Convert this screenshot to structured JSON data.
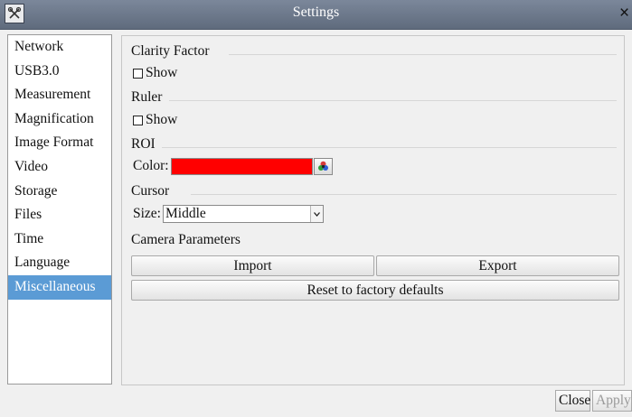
{
  "window": {
    "title": "Settings",
    "app_icon": "tools-icon",
    "close_glyph": "×"
  },
  "sidebar": {
    "items": [
      {
        "label": "Network"
      },
      {
        "label": "USB3.0"
      },
      {
        "label": "Measurement"
      },
      {
        "label": "Magnification"
      },
      {
        "label": "Image Format"
      },
      {
        "label": "Video"
      },
      {
        "label": "Storage"
      },
      {
        "label": "Files"
      },
      {
        "label": "Time"
      },
      {
        "label": "Language"
      },
      {
        "label": "Miscellaneous",
        "selected": true
      }
    ]
  },
  "clarity_factor": {
    "heading": "Clarity Factor",
    "show_label": "Show",
    "show_checked": false
  },
  "ruler": {
    "heading": "Ruler",
    "show_label": "Show",
    "show_checked": false
  },
  "roi": {
    "heading": "ROI",
    "color_label": "Color:",
    "color_value": "#ff0000",
    "picker_icon": "color-palette-icon"
  },
  "cursor": {
    "heading": "Cursor",
    "size_label": "Size:",
    "size_value": "Middle"
  },
  "camera_parameters": {
    "heading": "Camera Parameters",
    "import_label": "Import",
    "export_label": "Export",
    "reset_label": "Reset to factory defaults"
  },
  "footer": {
    "close_label": "Close",
    "apply_label": "Apply",
    "apply_enabled": false
  },
  "colors": {
    "titlebar": "#6b778a",
    "selection": "#5b9bd5"
  }
}
